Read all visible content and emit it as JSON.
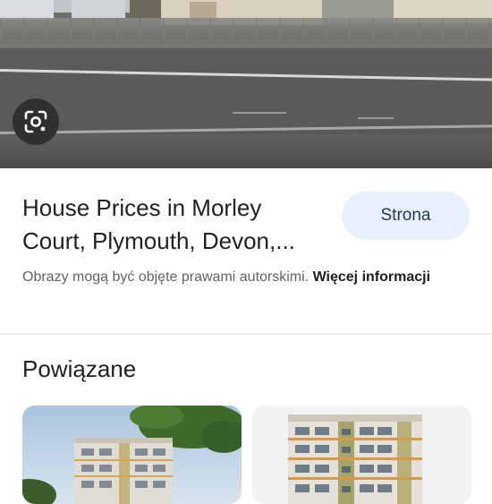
{
  "hero": {
    "image_description": "Street photo with road, fence and buildings",
    "lens_icon": "google-lens-icon"
  },
  "result": {
    "title_line1": "House Prices in Morley",
    "title_line2": "Court, Plymouth, Devon,...",
    "site_button_label": "Strona"
  },
  "notice": {
    "text": "Obrazy mogą być objęte prawami autorskimi.",
    "more_link": "Więcej informacji"
  },
  "related": {
    "heading": "Powiązane"
  },
  "colors": {
    "site_button_bg": "#e8f0fb",
    "site_button_text": "#1e3a5a",
    "title_text": "#202124",
    "secondary_text": "#5f6368"
  }
}
